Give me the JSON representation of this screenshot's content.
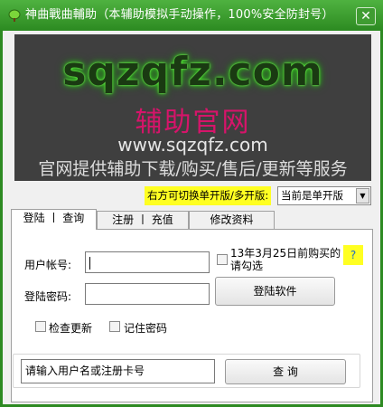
{
  "window": {
    "title": "神曲戰曲輔助（本辅助模拟手动操作，100%安全防封号）",
    "close_label": "✕"
  },
  "banner": {
    "logo_text": "sqzqfz.com",
    "cn_title": "辅助官网",
    "url": "www.sqzqfz.com",
    "services": "官网提供辅助下载/购买/售后/更新等服务"
  },
  "mode": {
    "label": "右方可切换单开版/多开版:",
    "selected": "当前是单开版"
  },
  "tabs": [
    {
      "label": "登陆 丨 查询",
      "active": true
    },
    {
      "label": "注册 丨 充值",
      "active": false
    },
    {
      "label": "修改资料",
      "active": false
    }
  ],
  "login": {
    "account_label": "用户帐号:",
    "account_value": "",
    "password_label": "登陆密码:",
    "password_value": "",
    "purchase_checkbox_label": "13年3月25日前购买的请勾选",
    "help_label": "?",
    "login_button": "登陆软件",
    "check_update_label": "检查更新",
    "remember_password_label": "记住密码"
  },
  "query": {
    "input_value": "请输入用户名或注册卡号",
    "button_label": "查 询"
  },
  "colors": {
    "frame_green": "#2d8a22",
    "highlight_yellow": "#ffff22",
    "banner_bg": "#3f3f3f",
    "banner_magenta": "#d6146a"
  }
}
